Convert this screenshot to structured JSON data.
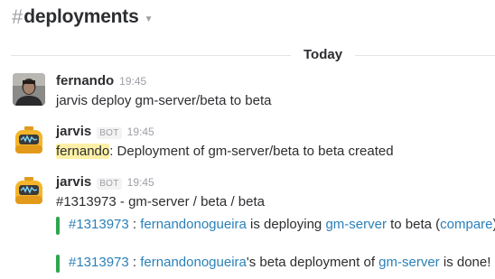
{
  "channel": {
    "hash": "#",
    "name": "deployments",
    "caret": "⌄"
  },
  "day_divider": "Today",
  "messages": [
    {
      "author": "fernando",
      "time": "19:45",
      "text": "jarvis deploy gm-server/beta to beta"
    },
    {
      "author": "jarvis",
      "bot_label": "BOT",
      "time": "19:45",
      "mention": "fernando",
      "text": ": Deployment of gm-server/beta to beta created"
    },
    {
      "author": "jarvis",
      "bot_label": "BOT",
      "time": "19:45",
      "text": "#1313973 - gm-server / beta / beta",
      "attachments": [
        {
          "id_link": "#1313973",
          "sep": " : ",
          "user_link": "fernandonogueira",
          "mid": " is deploying ",
          "repo_link": "gm-server",
          "tail": " to beta (",
          "compare_link": "compare",
          "end": ")"
        },
        {
          "id_link": "#1313973",
          "sep": " : ",
          "user_link": "fernandonogueira",
          "mid": "'s beta deployment of ",
          "repo_link": "gm-server",
          "tail": " is done!"
        }
      ]
    }
  ],
  "colors": {
    "link": "#2a80b9",
    "attachment_bar": "#2fa44f",
    "mention_bg": "#fdf0a6"
  },
  "icons": {
    "user_avatar": "photo-avatar",
    "bot_avatar": "robot-avatar"
  }
}
